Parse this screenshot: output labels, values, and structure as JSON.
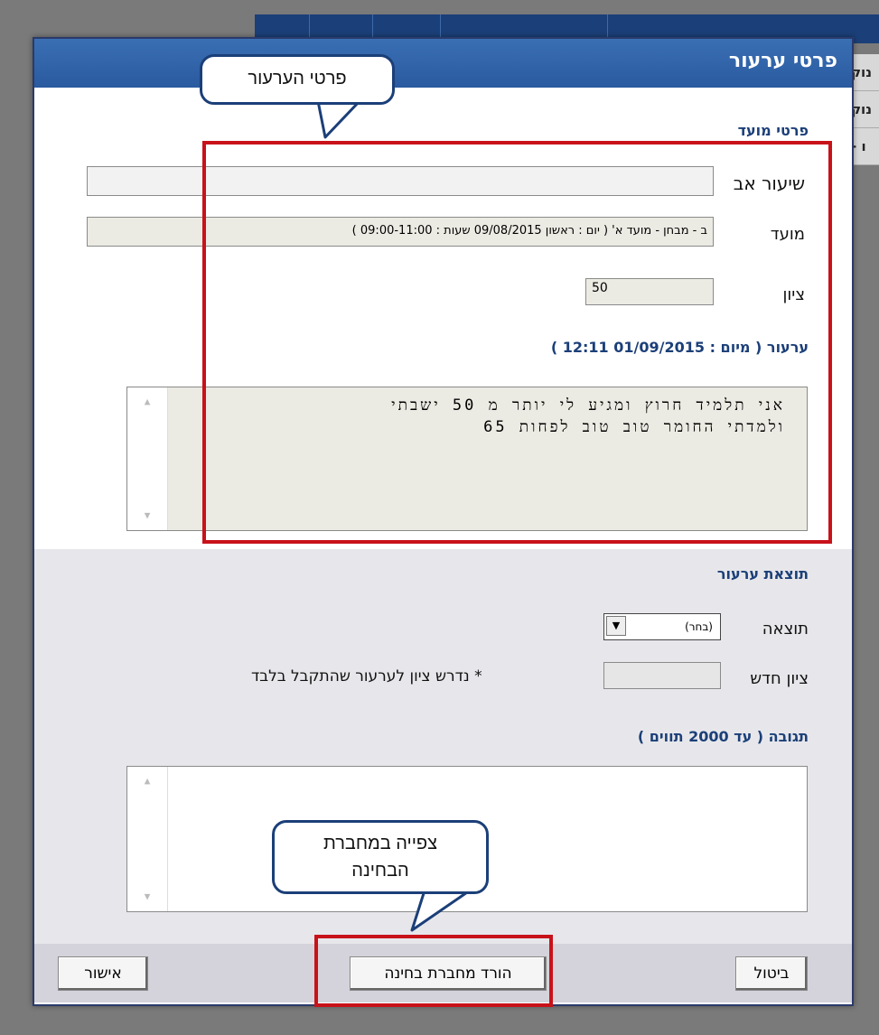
{
  "background": {
    "rows": [
      "נוק",
      "נוק",
      "- ו"
    ]
  },
  "dialog": {
    "title": "פרטי ערעור",
    "slot_section": {
      "title": "פרטי מועד",
      "course_label": "שיעור אב",
      "course_value": "",
      "session_label": "מועד",
      "session_value": "ב - מבחן - מועד א' ( יום : ראשון 09/08/2015 שעות : 09:00-11:00 )",
      "grade_label": "ציון",
      "grade_value": "50"
    },
    "appeal": {
      "title": "ערעור ( מיום : 01/09/2015 12:11 )",
      "text_line1": "אני תלמיד חרוץ ומגיע לי יותר מ 50 ישבתי",
      "text_line2": "ולמדתי החומר טוב טוב לפחות 65"
    },
    "result_section": {
      "title": "תוצאת ערעור",
      "result_label": "תוצאה",
      "result_selected": "(בחר)",
      "new_grade_label": "ציון חדש",
      "new_grade_value": "",
      "new_grade_note": "* נדרש ציון לערעור שהתקבל בלבד",
      "response_title": "תגובה ( עד 2000 תווים )",
      "response_value": ""
    },
    "buttons": {
      "cancel": "ביטול",
      "download": "הורד מחברת בחינה",
      "confirm": "אישור"
    }
  },
  "annotations": {
    "callout_top": "פרטי הערעור",
    "callout_bottom_line1": "צפייה במחברת",
    "callout_bottom_line2": "הבחינה"
  },
  "colors": {
    "titlebar": "#2a5aa0",
    "section_title": "#1b3f78",
    "highlight": "#c8121a"
  }
}
